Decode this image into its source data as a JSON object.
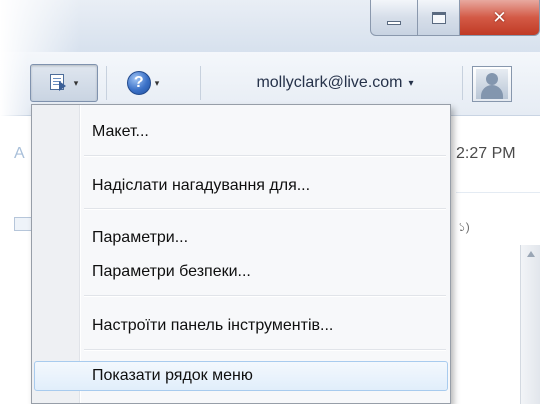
{
  "window": {
    "minimize_icon": "minimize-icon",
    "maximize_icon": "maximize-icon",
    "close_icon": "close-icon",
    "close_glyph": "✕"
  },
  "toolbar": {
    "view_button_icon": "layout-icon",
    "help_icon": "help-icon",
    "help_glyph": "?",
    "caret_glyph": "▾",
    "account_email": "mollyclark@live.com",
    "avatar_icon": "user-avatar-icon"
  },
  "background": {
    "left_letter": "A",
    "time": "2:27 PM",
    "small_text": "১)"
  },
  "menu": {
    "items": [
      {
        "label": "Макет..."
      },
      {
        "label": "Надіслати нагадування для..."
      },
      {
        "label": "Параметри..."
      },
      {
        "label": "Параметри безпеки..."
      },
      {
        "label": "Настроїти панель інструментів..."
      },
      {
        "label": "Показати рядок меню",
        "highlighted": true
      }
    ]
  },
  "colors": {
    "menu_highlight_border": "#a8cbee",
    "menu_highlight_fill": "#e1eefb",
    "close_button": "#c03a25"
  }
}
